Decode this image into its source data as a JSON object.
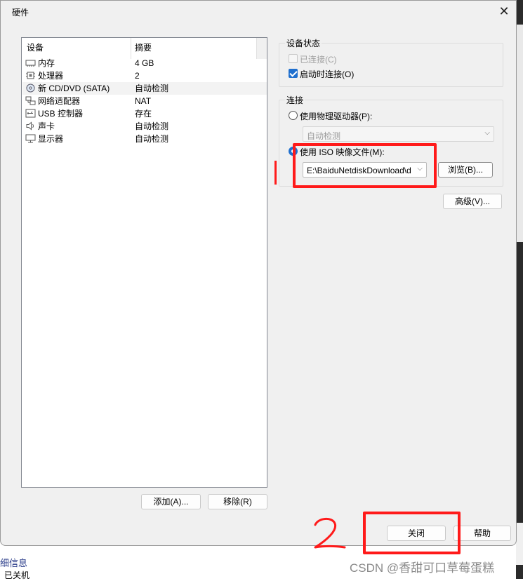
{
  "dialog": {
    "title": "硬件",
    "close_glyph": "✕"
  },
  "device_list": {
    "headers": {
      "device": "设备",
      "summary": "摘要"
    },
    "rows": [
      {
        "name": "内存",
        "summary": "4 GB",
        "icon": "memory-icon"
      },
      {
        "name": "处理器",
        "summary": "2",
        "icon": "cpu-icon"
      },
      {
        "name": "新 CD/DVD (SATA)",
        "summary": "自动检测",
        "icon": "cd-dvd-icon"
      },
      {
        "name": "网络适配器",
        "summary": "NAT",
        "icon": "network-icon"
      },
      {
        "name": "USB 控制器",
        "summary": "存在",
        "icon": "usb-icon"
      },
      {
        "name": "声卡",
        "summary": "自动检测",
        "icon": "speaker-icon"
      },
      {
        "name": "显示器",
        "summary": "自动检测",
        "icon": "monitor-icon"
      }
    ],
    "add_label": "添加(A)...",
    "remove_label": "移除(R)"
  },
  "device_status": {
    "title": "设备状态",
    "connected_label": "已连接(C)",
    "connect_at_power_on_label": "启动时连接(O)"
  },
  "connection": {
    "title": "连接",
    "physical_label": "使用物理驱动器(P):",
    "physical_value": "自动检测",
    "iso_label": "使用 ISO 映像文件(M):",
    "iso_value": "E:\\BaiduNetdiskDownload\\d",
    "browse_label": "浏览(B)..."
  },
  "advanced_label": "高级(V)...",
  "footer": {
    "close_label": "关闭",
    "help_label": "帮助"
  },
  "background": {
    "details_label": "细信息",
    "state_label": "已关机"
  },
  "annotations": {
    "mark_1": "1",
    "mark_2": "2",
    "color": "#ff1a1a"
  },
  "watermark": "CSDN @香甜可口草莓蛋糕"
}
